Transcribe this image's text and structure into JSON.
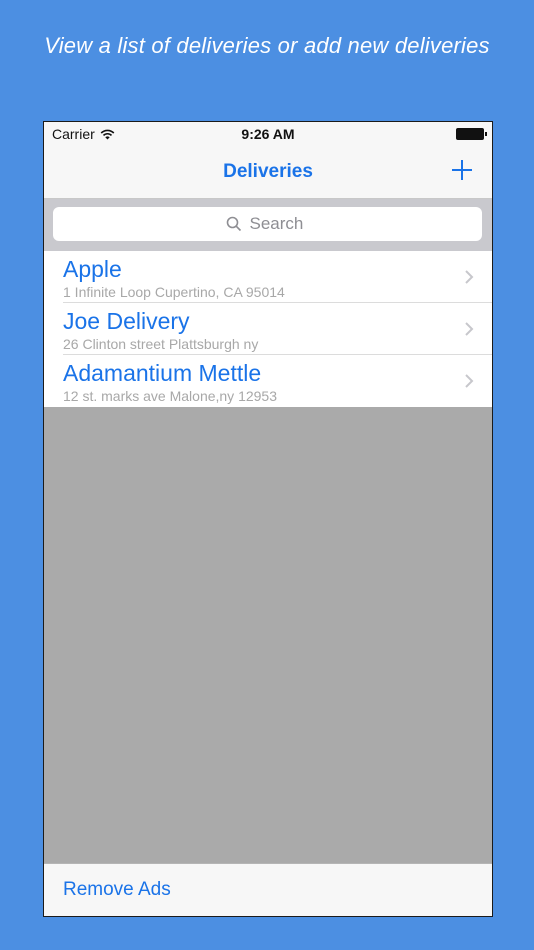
{
  "headline": "View a list of deliveries or add new deliveries",
  "status_bar": {
    "carrier": "Carrier",
    "time": "9:26 AM"
  },
  "nav": {
    "title": "Deliveries",
    "add_icon": "plus-icon"
  },
  "search": {
    "placeholder": "Search",
    "icon": "search-icon"
  },
  "deliveries": [
    {
      "name": "Apple",
      "address": "1 Infinite Loop Cupertino, CA 95014"
    },
    {
      "name": "Joe Delivery",
      "address": "26 Clinton street Plattsburgh ny"
    },
    {
      "name": "Adamantium Mettle",
      "address": "12 st. marks ave Malone,ny 12953"
    }
  ],
  "toolbar": {
    "remove_ads_label": "Remove Ads"
  },
  "colors": {
    "background": "#4c8fe2",
    "tint": "#1a73e8",
    "empty_area": "#aaaaaa"
  }
}
